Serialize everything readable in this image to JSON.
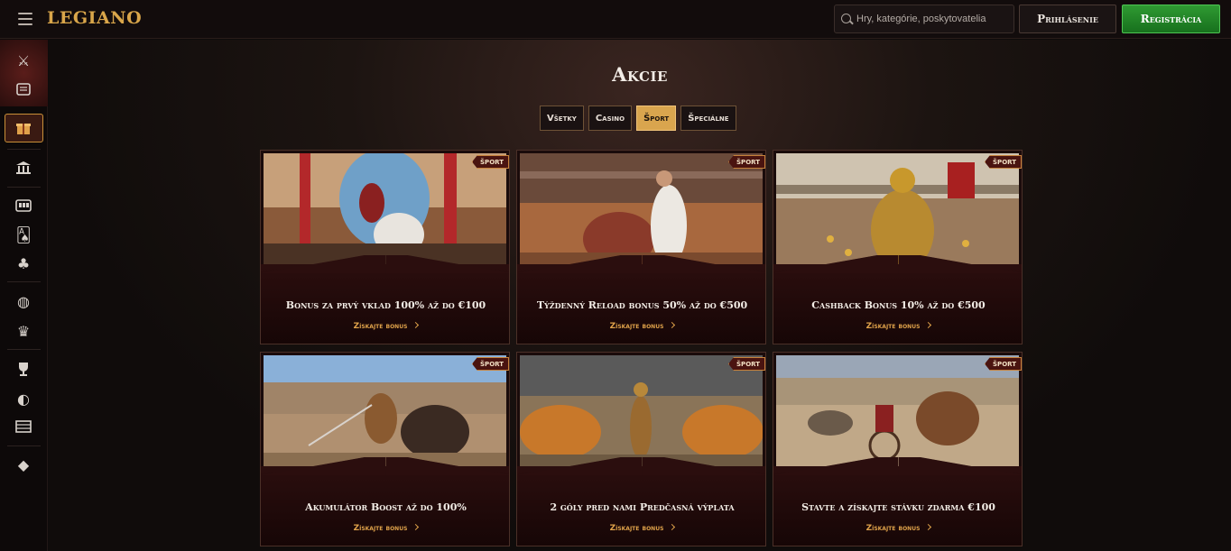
{
  "header": {
    "logo": "LEGIANO",
    "search_placeholder": "Hry, kategórie, poskytovatelia",
    "login_label": "Prihlásenie",
    "register_label": "Registrácia"
  },
  "sidebar": {
    "items": [
      "swords-icon",
      "scroll-icon",
      "gift-icon",
      "temple-icon",
      "slot-machine-icon",
      "cards-icon",
      "clover-icon",
      "globe-icon",
      "crown-icon",
      "trophy-icon",
      "ball-icon",
      "table-icon",
      "diamond-icon"
    ]
  },
  "page": {
    "title": "Akcie",
    "filters": [
      "Všetky",
      "Casino",
      "Šport",
      "Špeciálne"
    ],
    "active_filter": "Šport"
  },
  "promos": [
    {
      "badge": "ŠPORT",
      "title": "Bonus za prvý vklad 100% až do €100",
      "link": "Získajte bonus"
    },
    {
      "badge": "ŠPORT",
      "title": "Týždenný Reload bonus 50% až do €500",
      "link": "Získajte bonus"
    },
    {
      "badge": "ŠPORT",
      "title": "Cashback Bonus 10% až do €500",
      "link": "Získajte bonus"
    },
    {
      "badge": "ŠPORT",
      "title": "Akumulátor Boost až do 100%",
      "link": "Získajte bonus"
    },
    {
      "badge": "ŠPORT",
      "title": "2 góly pred nami Predčasná výplata",
      "link": "Získajte bonus"
    },
    {
      "badge": "ŠPORT",
      "title": "Stavte a získajte stávku zdarma €100",
      "link": "Získajte bonus"
    }
  ],
  "colors": {
    "accent_gold": "#d9a54e",
    "register_green": "#2f9a32",
    "card_red": "#2b0e0e"
  }
}
